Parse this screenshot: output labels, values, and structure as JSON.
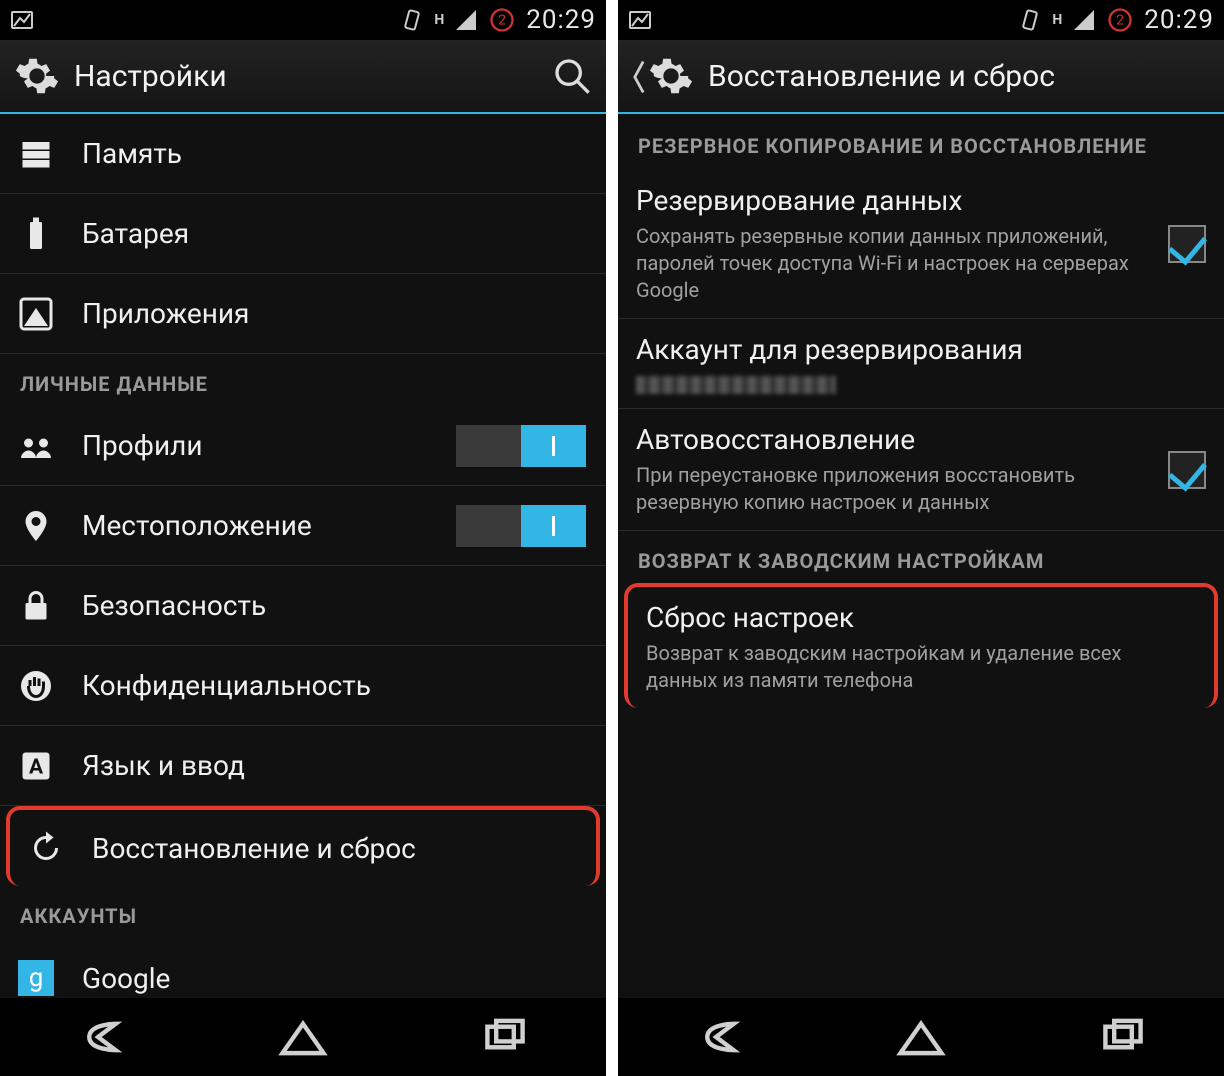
{
  "status": {
    "time": "20:29",
    "network_label": "H"
  },
  "screen1": {
    "title": "Настройки",
    "items": {
      "memory": "Память",
      "battery": "Батарея",
      "apps": "Приложения"
    },
    "section_personal": "ЛИЧНЫЕ ДАННЫЕ",
    "personal": {
      "profiles": "Профили",
      "location": "Местоположение",
      "security": "Безопасность",
      "privacy": "Конфиденциальность",
      "language": "Язык и ввод",
      "backup_reset": "Восстановление и сброс"
    },
    "section_accounts": "АККАУНТЫ",
    "accounts": {
      "google": "Google"
    }
  },
  "screen2": {
    "title": "Восстановление и сброс",
    "section_backup": "РЕЗЕРВНОЕ КОПИРОВАНИЕ И ВОССТАНОВЛЕНИЕ",
    "backup_data": {
      "title": "Резервирование данных",
      "sub": "Сохранять резервные копии данных приложений, паролей точек доступа Wi-Fi и настроек на серверах Google"
    },
    "backup_account": {
      "title": "Аккаунт для резервирования"
    },
    "auto_restore": {
      "title": "Автовосстановление",
      "sub": "При переустановке приложения восстановить резервную копию настроек и данных"
    },
    "section_factory": "ВОЗВРАТ К ЗАВОДСКИМ НАСТРОЙКАМ",
    "factory_reset": {
      "title": "Сброс настроек",
      "sub": "Возврат к заводским настройкам и удаление всех данных из памяти телефона"
    }
  }
}
